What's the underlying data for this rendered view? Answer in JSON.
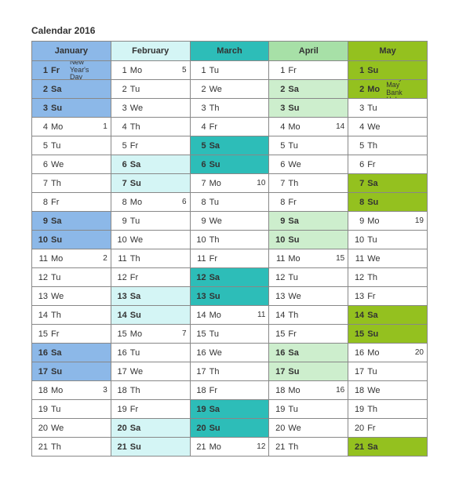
{
  "title": "Calendar 2016",
  "months": [
    {
      "name": "January",
      "days": [
        {
          "n": 1,
          "w": "Fr",
          "event": "New Year's Day",
          "hl": true
        },
        {
          "n": 2,
          "w": "Sa",
          "hl": true
        },
        {
          "n": 3,
          "w": "Su",
          "hl": true
        },
        {
          "n": 4,
          "w": "Mo",
          "wk": 1
        },
        {
          "n": 5,
          "w": "Tu"
        },
        {
          "n": 6,
          "w": "We"
        },
        {
          "n": 7,
          "w": "Th"
        },
        {
          "n": 8,
          "w": "Fr"
        },
        {
          "n": 9,
          "w": "Sa",
          "hl": true
        },
        {
          "n": 10,
          "w": "Su",
          "hl": true
        },
        {
          "n": 11,
          "w": "Mo",
          "wk": 2
        },
        {
          "n": 12,
          "w": "Tu"
        },
        {
          "n": 13,
          "w": "We"
        },
        {
          "n": 14,
          "w": "Th"
        },
        {
          "n": 15,
          "w": "Fr"
        },
        {
          "n": 16,
          "w": "Sa",
          "hl": true
        },
        {
          "n": 17,
          "w": "Su",
          "hl": true
        },
        {
          "n": 18,
          "w": "Mo",
          "wk": 3
        },
        {
          "n": 19,
          "w": "Tu"
        },
        {
          "n": 20,
          "w": "We"
        },
        {
          "n": 21,
          "w": "Th"
        }
      ]
    },
    {
      "name": "February",
      "days": [
        {
          "n": 1,
          "w": "Mo",
          "wk": 5
        },
        {
          "n": 2,
          "w": "Tu"
        },
        {
          "n": 3,
          "w": "We"
        },
        {
          "n": 4,
          "w": "Th"
        },
        {
          "n": 5,
          "w": "Fr"
        },
        {
          "n": 6,
          "w": "Sa",
          "hl": true
        },
        {
          "n": 7,
          "w": "Su",
          "hl": true
        },
        {
          "n": 8,
          "w": "Mo",
          "wk": 6
        },
        {
          "n": 9,
          "w": "Tu"
        },
        {
          "n": 10,
          "w": "We"
        },
        {
          "n": 11,
          "w": "Th"
        },
        {
          "n": 12,
          "w": "Fr"
        },
        {
          "n": 13,
          "w": "Sa",
          "hl": true
        },
        {
          "n": 14,
          "w": "Su",
          "hl": true
        },
        {
          "n": 15,
          "w": "Mo",
          "wk": 7
        },
        {
          "n": 16,
          "w": "Tu"
        },
        {
          "n": 17,
          "w": "We"
        },
        {
          "n": 18,
          "w": "Th"
        },
        {
          "n": 19,
          "w": "Fr"
        },
        {
          "n": 20,
          "w": "Sa",
          "hl": true
        },
        {
          "n": 21,
          "w": "Su",
          "hl": true
        }
      ]
    },
    {
      "name": "March",
      "days": [
        {
          "n": 1,
          "w": "Tu"
        },
        {
          "n": 2,
          "w": "We"
        },
        {
          "n": 3,
          "w": "Th"
        },
        {
          "n": 4,
          "w": "Fr"
        },
        {
          "n": 5,
          "w": "Sa",
          "hl": true
        },
        {
          "n": 6,
          "w": "Su",
          "hl": true
        },
        {
          "n": 7,
          "w": "Mo",
          "wk": 10
        },
        {
          "n": 8,
          "w": "Tu"
        },
        {
          "n": 9,
          "w": "We"
        },
        {
          "n": 10,
          "w": "Th"
        },
        {
          "n": 11,
          "w": "Fr"
        },
        {
          "n": 12,
          "w": "Sa",
          "hl": true
        },
        {
          "n": 13,
          "w": "Su",
          "hl": true
        },
        {
          "n": 14,
          "w": "Mo",
          "wk": 11
        },
        {
          "n": 15,
          "w": "Tu"
        },
        {
          "n": 16,
          "w": "We"
        },
        {
          "n": 17,
          "w": "Th"
        },
        {
          "n": 18,
          "w": "Fr"
        },
        {
          "n": 19,
          "w": "Sa",
          "hl": true
        },
        {
          "n": 20,
          "w": "Su",
          "hl": true
        },
        {
          "n": 21,
          "w": "Mo",
          "wk": 12
        }
      ]
    },
    {
      "name": "April",
      "days": [
        {
          "n": 1,
          "w": "Fr"
        },
        {
          "n": 2,
          "w": "Sa",
          "hl": true
        },
        {
          "n": 3,
          "w": "Su",
          "hl": true
        },
        {
          "n": 4,
          "w": "Mo",
          "wk": 14
        },
        {
          "n": 5,
          "w": "Tu"
        },
        {
          "n": 6,
          "w": "We"
        },
        {
          "n": 7,
          "w": "Th"
        },
        {
          "n": 8,
          "w": "Fr"
        },
        {
          "n": 9,
          "w": "Sa",
          "hl": true
        },
        {
          "n": 10,
          "w": "Su",
          "hl": true
        },
        {
          "n": 11,
          "w": "Mo",
          "wk": 15
        },
        {
          "n": 12,
          "w": "Tu"
        },
        {
          "n": 13,
          "w": "We"
        },
        {
          "n": 14,
          "w": "Th"
        },
        {
          "n": 15,
          "w": "Fr"
        },
        {
          "n": 16,
          "w": "Sa",
          "hl": true
        },
        {
          "n": 17,
          "w": "Su",
          "hl": true
        },
        {
          "n": 18,
          "w": "Mo",
          "wk": 16
        },
        {
          "n": 19,
          "w": "Tu"
        },
        {
          "n": 20,
          "w": "We"
        },
        {
          "n": 21,
          "w": "Th"
        }
      ]
    },
    {
      "name": "May",
      "days": [
        {
          "n": 1,
          "w": "Su",
          "hl": true
        },
        {
          "n": 2,
          "w": "Mo",
          "event": "Early May Bank Hol",
          "hl": true
        },
        {
          "n": 3,
          "w": "Tu"
        },
        {
          "n": 4,
          "w": "We"
        },
        {
          "n": 5,
          "w": "Th"
        },
        {
          "n": 6,
          "w": "Fr"
        },
        {
          "n": 7,
          "w": "Sa",
          "hl": true
        },
        {
          "n": 8,
          "w": "Su",
          "hl": true
        },
        {
          "n": 9,
          "w": "Mo",
          "wk": 19
        },
        {
          "n": 10,
          "w": "Tu"
        },
        {
          "n": 11,
          "w": "We"
        },
        {
          "n": 12,
          "w": "Th"
        },
        {
          "n": 13,
          "w": "Fr"
        },
        {
          "n": 14,
          "w": "Sa",
          "hl": true
        },
        {
          "n": 15,
          "w": "Su",
          "hl": true
        },
        {
          "n": 16,
          "w": "Mo",
          "wk": 20
        },
        {
          "n": 17,
          "w": "Tu"
        },
        {
          "n": 18,
          "w": "We"
        },
        {
          "n": 19,
          "w": "Th"
        },
        {
          "n": 20,
          "w": "Fr"
        },
        {
          "n": 21,
          "w": "Sa",
          "hl": true
        }
      ]
    }
  ]
}
